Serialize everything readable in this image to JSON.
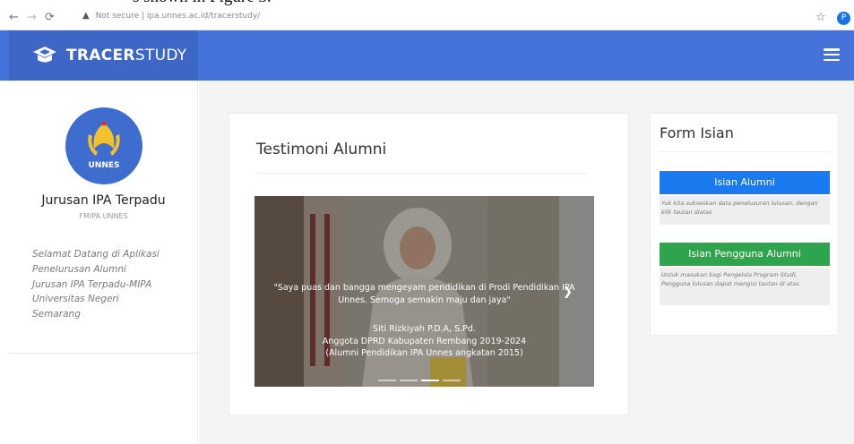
{
  "caption": "s shown in Figure 3.",
  "browser": {
    "url_warning": "Not secure",
    "url": "ipa.unnes.ac.id/tracerstudy/",
    "profile_initial": "P"
  },
  "header": {
    "brand_bold": "TRACER",
    "brand_light": "STUDY",
    "bg_color": "#4472d8"
  },
  "sidebar": {
    "logo_text": "UNNES",
    "department": "Jurusan IPA Terpadu",
    "faculty": "FMIPA UNNES",
    "welcome_lines": [
      "Selamat Datang di Aplikasi",
      "Penelurusan Alumni",
      "Jurusan IPA Terpadu-MIPA",
      "Universitas Negeri",
      "Semarang"
    ]
  },
  "testimoni": {
    "title": "Testimoni Alumni",
    "quote": "\"Saya puas dan bangga mengeyam pendidikan di Prodi Pendidikan IPA Unnes. Semoga semakin maju dan jaya\"",
    "person_name": "Siti Rizkiyah P.D.A, S.Pd.",
    "person_role": "Anggota DPRD Kabupaten Rembang 2019-2024",
    "person_note": "(Alumni Pendidikan IPA Unnes angkatan 2015)"
  },
  "form": {
    "title": "Form Isian",
    "alumni_button": "Isian Alumni",
    "alumni_note": "Yuk kita sukseskan data penelusuran lulusan, dengan klik tautan diatas",
    "pengguna_button": "Isian Pengguna Alumni",
    "pengguna_note": "Untuk masukan bagi Pengelola Program Studi, Pengguna lulusan dapat mengisi tautan di atas"
  }
}
